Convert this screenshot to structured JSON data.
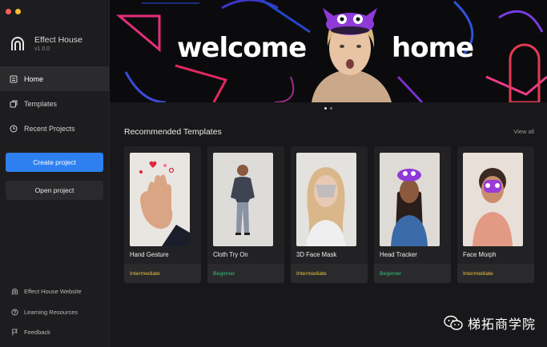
{
  "app": {
    "name": "Effect House",
    "version": "v1.0.0"
  },
  "sidebar": {
    "nav": [
      {
        "label": "Home",
        "icon": "home-icon",
        "active": true
      },
      {
        "label": "Templates",
        "icon": "templates-icon",
        "active": false
      },
      {
        "label": "Recent Projects",
        "icon": "clock-icon",
        "active": false
      }
    ],
    "create_label": "Create project",
    "open_label": "Open project",
    "footer": [
      {
        "label": "Effect House Website",
        "icon": "effect-house-logo-icon"
      },
      {
        "label": "Learning Resources",
        "icon": "help-circle-icon"
      },
      {
        "label": "Feedback",
        "icon": "flag-icon"
      }
    ]
  },
  "hero": {
    "title_left": "welcome",
    "title_right": "home",
    "slides": 2,
    "active_slide": 0
  },
  "recommended": {
    "title": "Recommended Templates",
    "view_all": "View all",
    "cards": [
      {
        "name": "Hand Gesture",
        "level": "Intermediate"
      },
      {
        "name": "Cloth Try On",
        "level": "Beginner"
      },
      {
        "name": "3D Face Mask",
        "level": "Intermediate"
      },
      {
        "name": "Head Tracker",
        "level": "Beginner"
      },
      {
        "name": "Face Morph",
        "level": "Intermediate"
      }
    ]
  },
  "watermark": {
    "text": "梯拓商学院",
    "icon": "wechat-icon"
  },
  "colors": {
    "accent": "#2e80f0",
    "intermediate": "#e8c23a",
    "beginner": "#35c07a",
    "close": "#ff5f57",
    "minimize": "#febc2e"
  }
}
